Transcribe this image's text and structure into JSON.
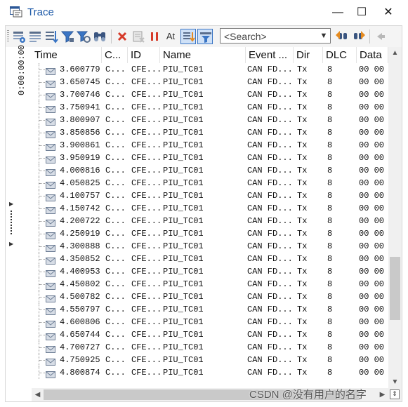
{
  "window": {
    "title": "Trace",
    "minimize": "—",
    "maximize": "☐",
    "close": "✕"
  },
  "toolbar": {
    "buttons": [
      "trace-settings-icon",
      "trace-window-icon",
      "sort-icon",
      "filter-icon",
      "filter-advanced-icon",
      "find-icon",
      "delete-icon",
      "clear-icon",
      "pause-icon",
      "time-absolute-icon",
      "scroll-lock-icon",
      "auto-scroll-icon",
      "find-prev-icon",
      "find-next-icon",
      "back-icon"
    ],
    "search_placeholder": "<Search>",
    "time_toggle_label": "At",
    "colors": {
      "accent": "#3a75c4",
      "delete": "#d63b2a",
      "pause": "#d63b2a"
    }
  },
  "left_panel": {
    "time_label": "0:00:00:00"
  },
  "columns": [
    "Time",
    "C...",
    "ID",
    "Name",
    "Event ...",
    "Dir",
    "DLC",
    "Data"
  ],
  "rows": [
    {
      "time": "3.600779",
      "channel": "C...",
      "id": "CFE...",
      "name": "PIU_TC01",
      "event": "CAN FD...",
      "dir": "Tx",
      "dlc": "8",
      "data": "00 00"
    },
    {
      "time": "3.650745",
      "channel": "C...",
      "id": "CFE...",
      "name": "PIU_TC01",
      "event": "CAN FD...",
      "dir": "Tx",
      "dlc": "8",
      "data": "00 00"
    },
    {
      "time": "3.700746",
      "channel": "C...",
      "id": "CFE...",
      "name": "PIU_TC01",
      "event": "CAN FD...",
      "dir": "Tx",
      "dlc": "8",
      "data": "00 00"
    },
    {
      "time": "3.750941",
      "channel": "C...",
      "id": "CFE...",
      "name": "PIU_TC01",
      "event": "CAN FD...",
      "dir": "Tx",
      "dlc": "8",
      "data": "00 00"
    },
    {
      "time": "3.800907",
      "channel": "C...",
      "id": "CFE...",
      "name": "PIU_TC01",
      "event": "CAN FD...",
      "dir": "Tx",
      "dlc": "8",
      "data": "00 00"
    },
    {
      "time": "3.850856",
      "channel": "C...",
      "id": "CFE...",
      "name": "PIU_TC01",
      "event": "CAN FD...",
      "dir": "Tx",
      "dlc": "8",
      "data": "00 00"
    },
    {
      "time": "3.900861",
      "channel": "C...",
      "id": "CFE...",
      "name": "PIU_TC01",
      "event": "CAN FD...",
      "dir": "Tx",
      "dlc": "8",
      "data": "00 00"
    },
    {
      "time": "3.950919",
      "channel": "C...",
      "id": "CFE...",
      "name": "PIU_TC01",
      "event": "CAN FD...",
      "dir": "Tx",
      "dlc": "8",
      "data": "00 00"
    },
    {
      "time": "4.000816",
      "channel": "C...",
      "id": "CFE...",
      "name": "PIU_TC01",
      "event": "CAN FD...",
      "dir": "Tx",
      "dlc": "8",
      "data": "00 00"
    },
    {
      "time": "4.050825",
      "channel": "C...",
      "id": "CFE...",
      "name": "PIU_TC01",
      "event": "CAN FD...",
      "dir": "Tx",
      "dlc": "8",
      "data": "00 00"
    },
    {
      "time": "4.100757",
      "channel": "C...",
      "id": "CFE...",
      "name": "PIU_TC01",
      "event": "CAN FD...",
      "dir": "Tx",
      "dlc": "8",
      "data": "00 00"
    },
    {
      "time": "4.150742",
      "channel": "C...",
      "id": "CFE...",
      "name": "PIU_TC01",
      "event": "CAN FD...",
      "dir": "Tx",
      "dlc": "8",
      "data": "00 00"
    },
    {
      "time": "4.200722",
      "channel": "C...",
      "id": "CFE...",
      "name": "PIU_TC01",
      "event": "CAN FD...",
      "dir": "Tx",
      "dlc": "8",
      "data": "00 00"
    },
    {
      "time": "4.250919",
      "channel": "C...",
      "id": "CFE...",
      "name": "PIU_TC01",
      "event": "CAN FD...",
      "dir": "Tx",
      "dlc": "8",
      "data": "00 00"
    },
    {
      "time": "4.300888",
      "channel": "C...",
      "id": "CFE...",
      "name": "PIU_TC01",
      "event": "CAN FD...",
      "dir": "Tx",
      "dlc": "8",
      "data": "00 00"
    },
    {
      "time": "4.350852",
      "channel": "C...",
      "id": "CFE...",
      "name": "PIU_TC01",
      "event": "CAN FD...",
      "dir": "Tx",
      "dlc": "8",
      "data": "00 00"
    },
    {
      "time": "4.400953",
      "channel": "C...",
      "id": "CFE...",
      "name": "PIU_TC01",
      "event": "CAN FD...",
      "dir": "Tx",
      "dlc": "8",
      "data": "00 00"
    },
    {
      "time": "4.450802",
      "channel": "C...",
      "id": "CFE...",
      "name": "PIU_TC01",
      "event": "CAN FD...",
      "dir": "Tx",
      "dlc": "8",
      "data": "00 00"
    },
    {
      "time": "4.500782",
      "channel": "C...",
      "id": "CFE...",
      "name": "PIU_TC01",
      "event": "CAN FD...",
      "dir": "Tx",
      "dlc": "8",
      "data": "00 00"
    },
    {
      "time": "4.550797",
      "channel": "C...",
      "id": "CFE...",
      "name": "PIU_TC01",
      "event": "CAN FD...",
      "dir": "Tx",
      "dlc": "8",
      "data": "00 00"
    },
    {
      "time": "4.600806",
      "channel": "C...",
      "id": "CFE...",
      "name": "PIU_TC01",
      "event": "CAN FD...",
      "dir": "Tx",
      "dlc": "8",
      "data": "00 00"
    },
    {
      "time": "4.650744",
      "channel": "C...",
      "id": "CFE...",
      "name": "PIU_TC01",
      "event": "CAN FD...",
      "dir": "Tx",
      "dlc": "8",
      "data": "00 00"
    },
    {
      "time": "4.700727",
      "channel": "C...",
      "id": "CFE...",
      "name": "PIU_TC01",
      "event": "CAN FD...",
      "dir": "Tx",
      "dlc": "8",
      "data": "00 00"
    },
    {
      "time": "4.750925",
      "channel": "C...",
      "id": "CFE...",
      "name": "PIU_TC01",
      "event": "CAN FD...",
      "dir": "Tx",
      "dlc": "8",
      "data": "00 00"
    },
    {
      "time": "4.800874",
      "channel": "C...",
      "id": "CFE...",
      "name": "PIU_TC01",
      "event": "CAN FD...",
      "dir": "Tx",
      "dlc": "8",
      "data": "00 00"
    }
  ],
  "scroll": {
    "vertical_position": 0.78,
    "vertical_visible": 0.2,
    "horizontal_position": 0.0,
    "horizontal_visible": 0.95
  },
  "watermark": "CSDN @没有用户的名字"
}
